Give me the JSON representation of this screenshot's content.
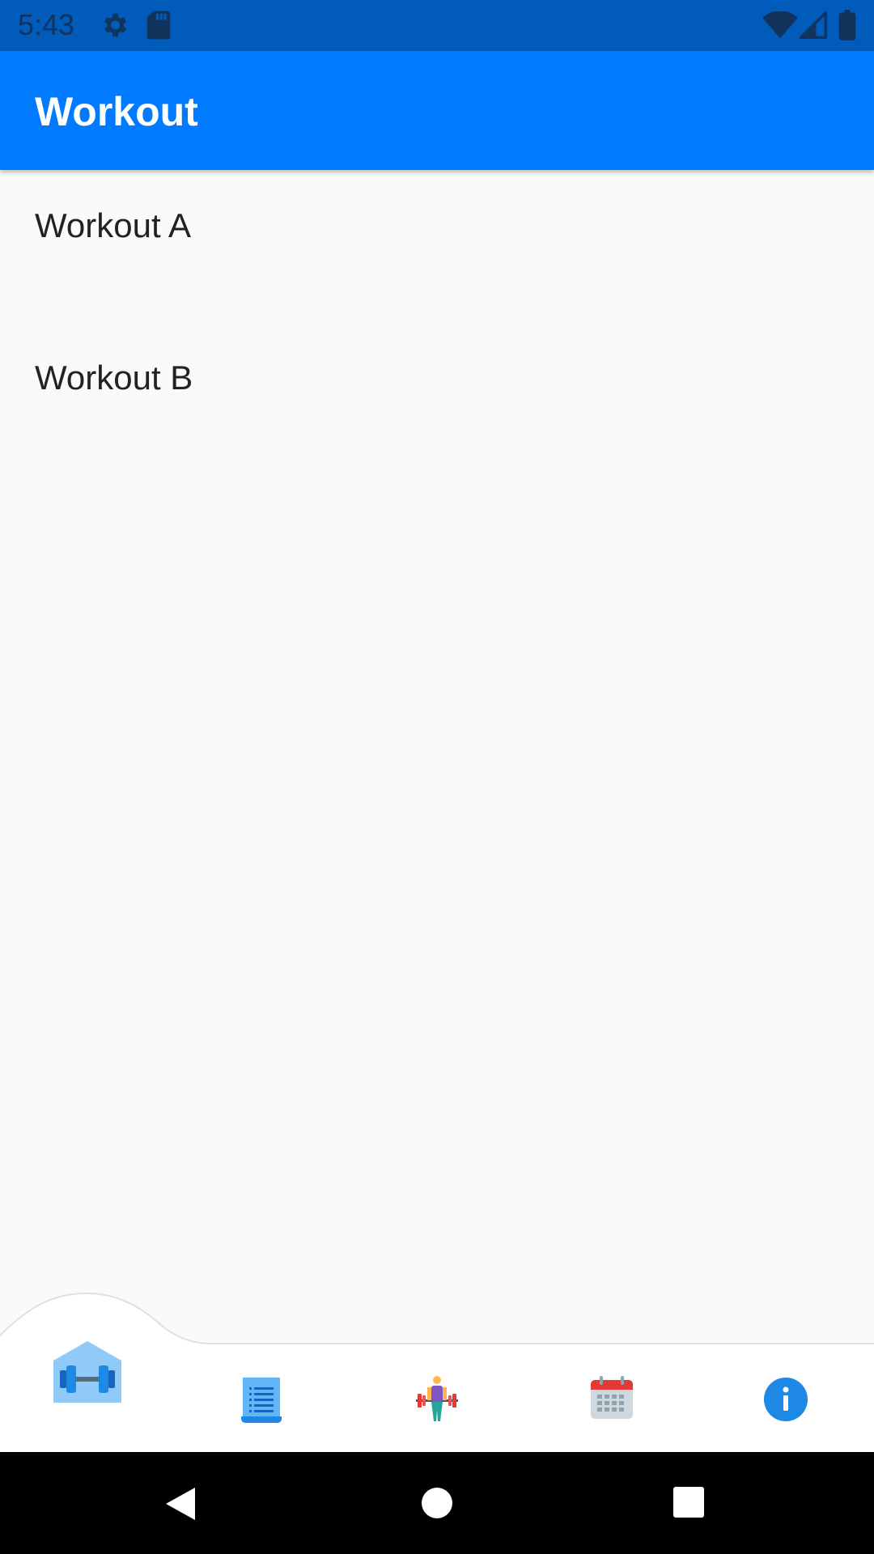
{
  "status_bar": {
    "time": "5:43",
    "icons": [
      "settings-icon",
      "sd-card-icon",
      "wifi-icon",
      "signal-icon",
      "battery-icon"
    ]
  },
  "app_bar": {
    "title": "Workout",
    "color": "#007bff"
  },
  "workouts": [
    {
      "label": "Workout A"
    },
    {
      "label": "Workout B"
    }
  ],
  "bottom_nav": {
    "items": [
      {
        "icon": "gym-home-icon",
        "selected": true
      },
      {
        "icon": "list-document-icon",
        "selected": false
      },
      {
        "icon": "weightlifter-icon",
        "selected": false
      },
      {
        "icon": "calendar-icon",
        "selected": false
      },
      {
        "icon": "info-icon",
        "selected": false
      }
    ]
  },
  "system_nav": {
    "icons": [
      "back-icon",
      "home-icon",
      "recents-icon"
    ]
  }
}
